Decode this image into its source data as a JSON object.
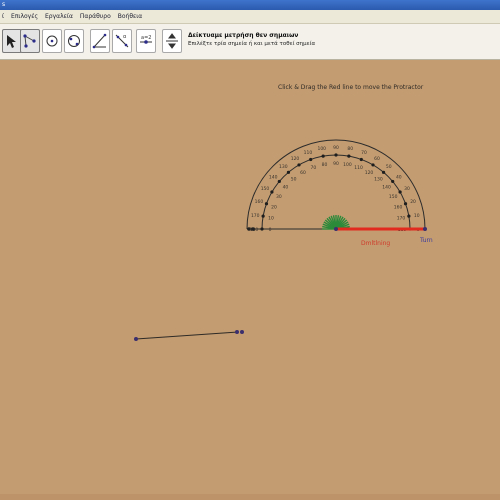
{
  "window": {
    "title": "s"
  },
  "menu": [
    "ί",
    "Επιλογές",
    "Εργαλεία",
    "Παράθυρο",
    "Βοήθεια"
  ],
  "toolbar": {
    "tools": [
      {
        "icon": "move-arrow-icon",
        "active": true
      },
      {
        "icon": "point-icon",
        "active": true
      },
      {
        "icon": "polygon-icon",
        "active": false
      },
      {
        "icon": "circle-icon",
        "active": false
      },
      {
        "icon": "conic-icon",
        "active": false
      },
      {
        "icon": "angle-icon",
        "active": false
      },
      {
        "icon": "reflect-icon",
        "active": false
      },
      {
        "icon": "slider-icon",
        "active": false
      },
      {
        "icon": "move-view-icon",
        "active": false
      }
    ],
    "active_tool_name": "Δείκτυαμε μετρήση θεν σημαιων",
    "active_tool_desc": "Επιλέξτε τρία σημεία ή και μετά τοθεί σημεία"
  },
  "canvas": {
    "instruction": "Click & Drag the Red line to move the Protractor",
    "protractor": {
      "outer_labels": [
        "0",
        "10",
        "20",
        "30",
        "40",
        "50",
        "60",
        "70",
        "80",
        "90",
        "100",
        "110",
        "120",
        "130",
        "140",
        "150",
        "160",
        "170",
        "180"
      ],
      "inner_labels": [
        "180",
        "170",
        "160",
        "150",
        "140",
        "130",
        "120",
        "110",
        "100",
        "90",
        "80",
        "70",
        "60",
        "50",
        "40",
        "30",
        "20",
        "10",
        "0"
      ],
      "handle_label": "Dmltlning",
      "turn_label": "Turn"
    },
    "segment": {
      "label": ""
    }
  },
  "colors": {
    "background": "#c39c71",
    "protractor_line": "#2b2b2b",
    "handle": "#e32a1f",
    "handle_text": "#cf3a2b",
    "turn_text": "#3a3aa0",
    "center_fan": "#2a8a3a",
    "point": "#3b2f6e"
  }
}
